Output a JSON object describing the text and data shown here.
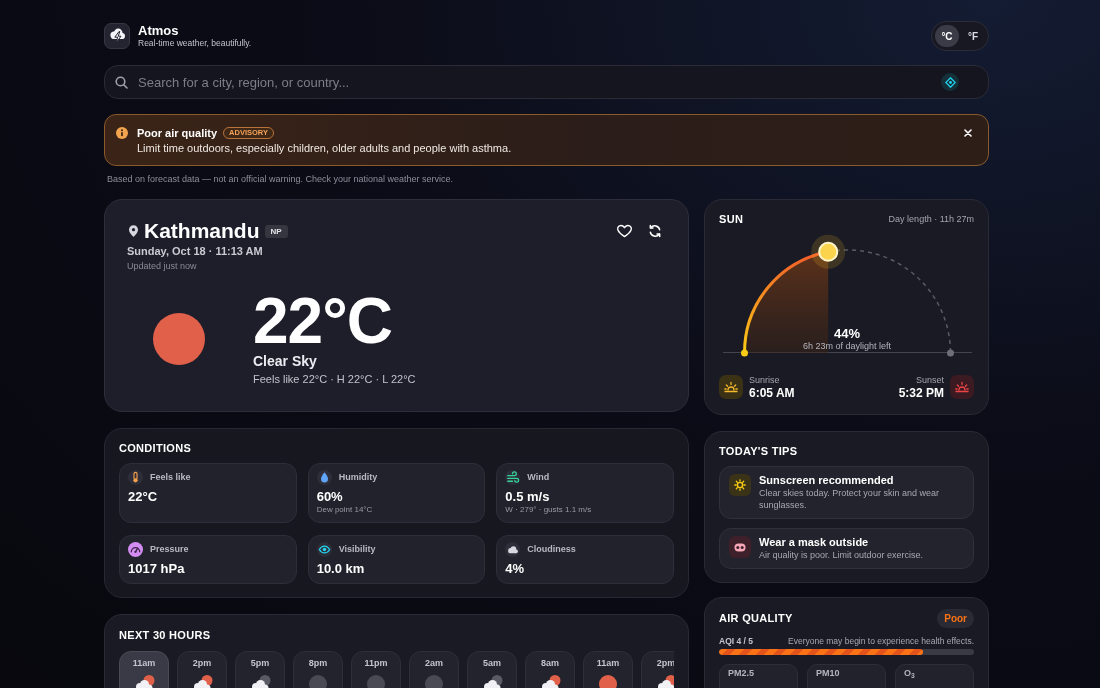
{
  "header": {
    "app_name": "Atmos",
    "tagline": "Real-time weather, beautifully.",
    "units": [
      {
        "label": "°C",
        "selected": true
      },
      {
        "label": "°F",
        "selected": false
      }
    ]
  },
  "search": {
    "placeholder": "Search for a city, region, or country..."
  },
  "alert": {
    "title": "Poor air quality",
    "badge": "ADVISORY",
    "message": "Limit time outdoors, especially children, older adults and people with asthma."
  },
  "disclaimer": "Based on forecast data — not an official warning. Check your national weather service.",
  "current": {
    "city": "Kathmandu",
    "country": "NP",
    "datetime": "Sunday, Oct 18 · 11:13 AM",
    "updated": "Updated just now",
    "favorite": false,
    "kind": "clear-day",
    "temperature": "22°C",
    "condition": "Clear Sky",
    "details": "Feels like 22°C · H 22°C · L 22°C"
  },
  "sun": {
    "title": "SUN",
    "day_length": "Day length · 11h 27m",
    "level": 0.44,
    "percent": "44%",
    "remaining": "6h 23m of daylight left",
    "sunrise": {
      "label": "Sunrise",
      "time": "6:05 AM"
    },
    "sunset": {
      "label": "Sunset",
      "time": "5:32 PM"
    }
  },
  "conditions": {
    "title": "CONDITIONS",
    "items": [
      {
        "kind": "temperature",
        "label": "Feels like",
        "value": "22°C"
      },
      {
        "kind": "humidity",
        "label": "Humidity",
        "value": "60%",
        "sub": "Dew point 14°C"
      },
      {
        "kind": "wind",
        "label": "Wind",
        "value": "0.5 m/s",
        "sub": "W · 279° · gusts 1.1 m/s"
      },
      {
        "kind": "pressure",
        "label": "Pressure",
        "value": "1017 hPa"
      },
      {
        "kind": "visibility",
        "label": "Visibility",
        "value": "10.0 km"
      },
      {
        "kind": "cloudiness",
        "label": "Cloudiness",
        "value": "4%"
      }
    ]
  },
  "tips": {
    "title": "TODAY'S TIPS",
    "items": [
      {
        "kind": "sun",
        "title": "Sunscreen recommended",
        "text": "Clear skies today. Protect your skin and wear sunglasses."
      },
      {
        "kind": "mask",
        "title": "Wear a mask outside",
        "text": "Air quality is poor. Limit outdoor exercise."
      }
    ]
  },
  "hourly": {
    "title": "NEXT 30 HOURS",
    "items": [
      {
        "time": "11am",
        "kind": "partly-cloudy-day",
        "selected": true
      },
      {
        "time": "2pm",
        "kind": "partly-cloudy-day",
        "selected": false
      },
      {
        "time": "5pm",
        "kind": "partly-cloudy-night",
        "selected": false
      },
      {
        "time": "8pm",
        "kind": "clear-night",
        "selected": false
      },
      {
        "time": "11pm",
        "kind": "clear-night",
        "selected": false
      },
      {
        "time": "2am",
        "kind": "clear-night",
        "selected": false
      },
      {
        "time": "5am",
        "kind": "partly-cloudy-night",
        "selected": false
      },
      {
        "time": "8am",
        "kind": "partly-cloudy-day",
        "selected": false
      },
      {
        "time": "11am",
        "kind": "clear-day",
        "selected": false
      },
      {
        "time": "2pm",
        "kind": "partly-cloudy-day",
        "selected": false
      }
    ]
  },
  "air_quality": {
    "title": "AIR QUALITY",
    "rating": "Poor",
    "index": "AQI 4 / 5",
    "message": "Everyone may begin to experience health effects.",
    "level": 0.8,
    "pollutants": [
      "PM2.5",
      "PM10",
      "O$_{3}$"
    ]
  }
}
